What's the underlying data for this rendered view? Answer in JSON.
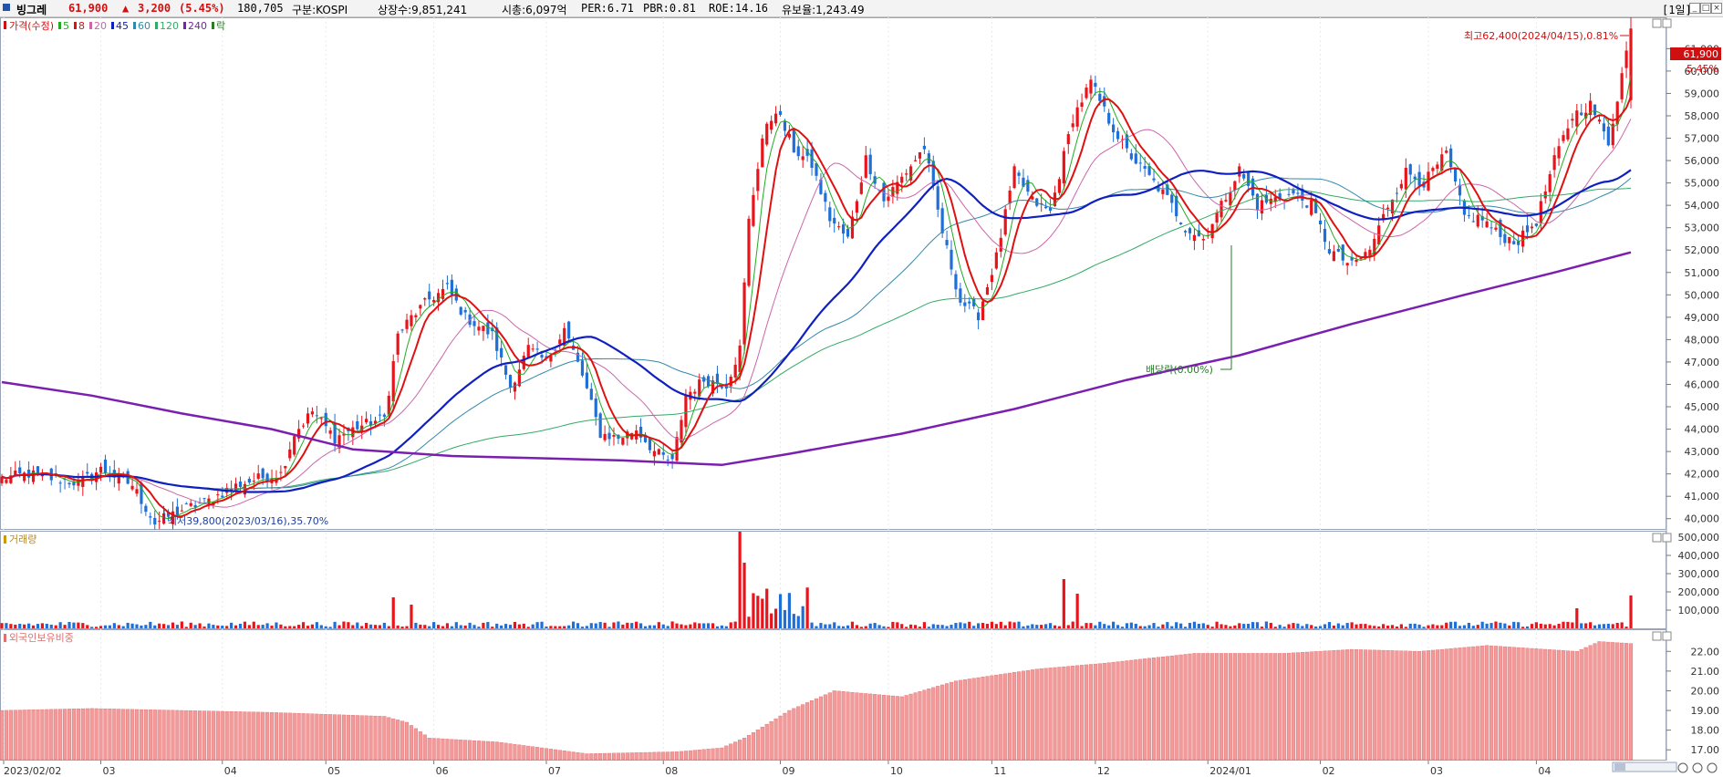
{
  "header": {
    "stock_name": "빙그레",
    "price": "61,900",
    "change_arrow": "▲",
    "change": "3,200",
    "change_pct": "(5.45%)",
    "volume": "180,705",
    "market": "구분:KOSPI",
    "shares": "상장수:9,851,241",
    "market_cap": "시총:6,097억",
    "per": "PER:6.71",
    "pbr": "PBR:0.81",
    "roe": "ROE:14.16",
    "retention": "유보율:1,243.49",
    "period": "[1일]"
  },
  "legend": {
    "price_label": "가격(수정)",
    "ma": [
      {
        "label": "5",
        "color": "#22aa22"
      },
      {
        "label": "8",
        "color": "#e01010"
      },
      {
        "label": "20",
        "color": "#cc66aa"
      },
      {
        "label": "45",
        "color": "#1020c0"
      },
      {
        "label": "60",
        "color": "#3388aa"
      },
      {
        "label": "120",
        "color": "#33aa66"
      },
      {
        "label": "240",
        "color": "#7a1fb0"
      }
    ],
    "ex_dividend_label": "락",
    "volume_label": "거래량",
    "foreign_label": "외국인보유비중"
  },
  "annotations": {
    "high": "최고62,400(2024/04/15),0.81%",
    "low": "최저39,800(2023/03/16),35.70%",
    "dividend": "배당락(0.00%)",
    "current_price": "61,900",
    "current_pct": "5.45%"
  },
  "chart_data": [
    {
      "type": "candlestick",
      "title": "빙그레 가격(수정)",
      "x_range": [
        "2023/02/02",
        "2024/04/15"
      ],
      "x_month_labels": [
        "2023/02/02",
        "03",
        "04",
        "05",
        "06",
        "07",
        "08",
        "09",
        "10",
        "11",
        "12",
        "2024/01",
        "02",
        "03",
        "04"
      ],
      "ylim": [
        39500,
        62400
      ],
      "yticks": [
        "40,000",
        "41,000",
        "42,000",
        "43,000",
        "44,000",
        "45,000",
        "46,000",
        "47,000",
        "48,000",
        "49,000",
        "50,000",
        "51,000",
        "52,000",
        "53,000",
        "54,000",
        "55,000",
        "56,000",
        "57,000",
        "58,000",
        "59,000",
        "60,000",
        "61,000"
      ],
      "close_path": [
        [
          0,
          41800
        ],
        [
          6,
          42000
        ],
        [
          11,
          41800
        ],
        [
          17,
          41600
        ],
        [
          22,
          42200
        ],
        [
          29,
          41500
        ],
        [
          34,
          39800
        ],
        [
          40,
          40400
        ],
        [
          46,
          40800
        ],
        [
          51,
          41400
        ],
        [
          57,
          41800
        ],
        [
          62,
          42000
        ],
        [
          65,
          43800
        ],
        [
          69,
          44800
        ],
        [
          74,
          43600
        ],
        [
          79,
          44100
        ],
        [
          85,
          44500
        ],
        [
          88,
          48200
        ],
        [
          91,
          49000
        ],
        [
          95,
          49800
        ],
        [
          99,
          50300
        ],
        [
          103,
          49000
        ],
        [
          109,
          48200
        ],
        [
          113,
          45900
        ],
        [
          117,
          47600
        ],
        [
          121,
          47000
        ],
        [
          125,
          48500
        ],
        [
          129,
          46400
        ],
        [
          133,
          43800
        ],
        [
          137,
          43600
        ],
        [
          141,
          44000
        ],
        [
          145,
          43000
        ],
        [
          149,
          42500
        ],
        [
          152,
          45500
        ],
        [
          156,
          46200
        ],
        [
          161,
          46000
        ],
        [
          164,
          47600
        ],
        [
          166,
          53300
        ],
        [
          169,
          57000
        ],
        [
          172,
          58300
        ],
        [
          176,
          56500
        ],
        [
          180,
          55800
        ],
        [
          184,
          53400
        ],
        [
          188,
          52500
        ],
        [
          192,
          56100
        ],
        [
          196,
          54200
        ],
        [
          201,
          55500
        ],
        [
          205,
          56600
        ],
        [
          209,
          52800
        ],
        [
          213,
          49700
        ],
        [
          217,
          49100
        ],
        [
          221,
          51700
        ],
        [
          225,
          55500
        ],
        [
          229,
          54200
        ],
        [
          233,
          53700
        ],
        [
          238,
          57900
        ],
        [
          242,
          59500
        ],
        [
          246,
          57800
        ],
        [
          250,
          56400
        ],
        [
          254,
          55500
        ],
        [
          259,
          54300
        ],
        [
          263,
          53000
        ],
        [
          267,
          52500
        ],
        [
          271,
          54000
        ],
        [
          275,
          55600
        ],
        [
          279,
          54000
        ],
        [
          283,
          54300
        ],
        [
          287,
          54500
        ],
        [
          291,
          54000
        ],
        [
          295,
          52000
        ],
        [
          300,
          51300
        ],
        [
          304,
          52000
        ],
        [
          308,
          54000
        ],
        [
          312,
          55500
        ],
        [
          316,
          55000
        ],
        [
          321,
          56300
        ],
        [
          325,
          53500
        ],
        [
          329,
          53400
        ],
        [
          333,
          52600
        ],
        [
          337,
          52400
        ],
        [
          341,
          53300
        ],
        [
          345,
          56000
        ],
        [
          349,
          58000
        ],
        [
          353,
          58500
        ],
        [
          357,
          56800
        ],
        [
          362,
          61900
        ]
      ],
      "ma_240_path": [
        [
          0,
          46100
        ],
        [
          20,
          45500
        ],
        [
          40,
          44700
        ],
        [
          60,
          44000
        ],
        [
          78,
          43100
        ],
        [
          100,
          42800
        ],
        [
          120,
          42700
        ],
        [
          138,
          42600
        ],
        [
          160,
          42400
        ],
        [
          175,
          42900
        ],
        [
          200,
          43800
        ],
        [
          225,
          44900
        ],
        [
          250,
          46200
        ],
        [
          275,
          47300
        ],
        [
          300,
          48700
        ],
        [
          325,
          50000
        ],
        [
          345,
          51000
        ],
        [
          362,
          51900
        ]
      ]
    },
    {
      "type": "bar",
      "title": "거래량",
      "ylim": [
        0,
        500000
      ],
      "yticks": [
        "100,000",
        "200,000",
        "300,000",
        "400,000",
        "500,000"
      ],
      "spikes": [
        {
          "x": 87,
          "value": 170000
        },
        {
          "x": 91,
          "value": 130000
        },
        {
          "x": 164,
          "value": 530000
        },
        {
          "x": 165,
          "value": 360000
        },
        {
          "x": 236,
          "value": 270000
        },
        {
          "x": 239,
          "value": 190000
        },
        {
          "x": 350,
          "value": 110000
        },
        {
          "x": 362,
          "value": 180705
        }
      ]
    },
    {
      "type": "bar",
      "title": "외국인보유비중",
      "ylim": [
        16.5,
        22.8
      ],
      "yticks": [
        "17.00",
        "18.00",
        "19.00",
        "20.00",
        "21.00",
        "22.00"
      ],
      "level_path": [
        [
          0,
          19.0
        ],
        [
          20,
          19.1
        ],
        [
          40,
          19.0
        ],
        [
          60,
          18.9
        ],
        [
          85,
          18.7
        ],
        [
          90,
          18.4
        ],
        [
          95,
          17.6
        ],
        [
          110,
          17.4
        ],
        [
          130,
          16.8
        ],
        [
          150,
          16.9
        ],
        [
          160,
          17.1
        ],
        [
          165,
          17.6
        ],
        [
          175,
          19.0
        ],
        [
          185,
          20.0
        ],
        [
          200,
          19.7
        ],
        [
          212,
          20.5
        ],
        [
          230,
          21.1
        ],
        [
          245,
          21.4
        ],
        [
          265,
          21.9
        ],
        [
          285,
          21.9
        ],
        [
          300,
          22.1
        ],
        [
          315,
          22.0
        ],
        [
          330,
          22.3
        ],
        [
          350,
          22.0
        ],
        [
          355,
          22.5
        ],
        [
          362,
          22.4
        ]
      ]
    }
  ]
}
